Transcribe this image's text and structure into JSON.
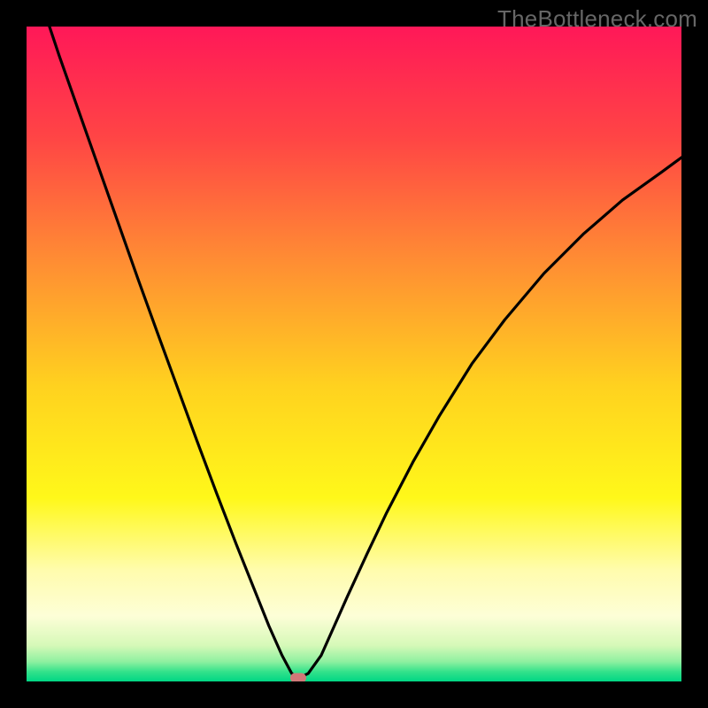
{
  "watermark": "TheBottleneck.com",
  "chart_data": {
    "type": "line",
    "title": "",
    "xlabel": "",
    "ylabel": "",
    "x_range": [
      0,
      1
    ],
    "y_range": [
      0,
      1
    ],
    "series": [
      {
        "name": "curve",
        "x": [
          0.035,
          0.05,
          0.08,
          0.11,
          0.14,
          0.17,
          0.2,
          0.23,
          0.26,
          0.29,
          0.32,
          0.35,
          0.37,
          0.39,
          0.405,
          0.415,
          0.43,
          0.45,
          0.47,
          0.49,
          0.52,
          0.55,
          0.59,
          0.63,
          0.68,
          0.73,
          0.79,
          0.85,
          0.91,
          0.97,
          1.0
        ],
        "y": [
          1.0,
          0.955,
          0.87,
          0.785,
          0.7,
          0.615,
          0.532,
          0.45,
          0.368,
          0.288,
          0.21,
          0.135,
          0.085,
          0.04,
          0.012,
          0.005,
          0.012,
          0.04,
          0.085,
          0.13,
          0.195,
          0.258,
          0.335,
          0.405,
          0.485,
          0.552,
          0.623,
          0.683,
          0.735,
          0.778,
          0.8
        ]
      }
    ],
    "marker": {
      "x": 0.415,
      "y": 0.005
    },
    "gradient_stops": [
      {
        "pos": 0.0,
        "color": "#ff1858"
      },
      {
        "pos": 0.17,
        "color": "#ff4545"
      },
      {
        "pos": 0.35,
        "color": "#ff8a34"
      },
      {
        "pos": 0.55,
        "color": "#ffd21f"
      },
      {
        "pos": 0.72,
        "color": "#fff81a"
      },
      {
        "pos": 0.83,
        "color": "#fffcad"
      },
      {
        "pos": 0.9,
        "color": "#fdfed7"
      },
      {
        "pos": 0.945,
        "color": "#d6f9b8"
      },
      {
        "pos": 0.97,
        "color": "#8ef0a0"
      },
      {
        "pos": 0.985,
        "color": "#34e28b"
      },
      {
        "pos": 1.0,
        "color": "#00d684"
      }
    ]
  }
}
